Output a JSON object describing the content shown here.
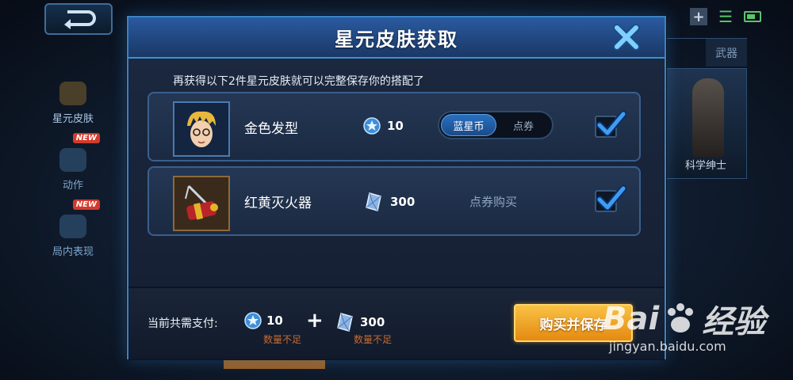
{
  "background": {
    "side_tabs": [
      {
        "label": "星元皮肤",
        "badge": ""
      },
      {
        "label": "动作",
        "badge": "NEW"
      },
      {
        "label": "局内表现",
        "badge": "NEW"
      }
    ],
    "right_tabs": [
      "",
      "武器"
    ],
    "hero_card_label": "科学绅士"
  },
  "modal": {
    "title": "星元皮肤获取",
    "subtitle": "再获得以下2件星元皮肤就可以完整保存你的搭配了",
    "items": [
      {
        "name": "金色发型",
        "price": "10",
        "price_currency": "blue-star-coin",
        "currency_options": [
          "蓝星币",
          "点券"
        ],
        "selected_currency": "蓝星币",
        "checked": true
      },
      {
        "name": "红黄灭火器",
        "price": "300",
        "price_currency": "voucher-crystal",
        "purchase_text": "点券购买",
        "checked": true
      }
    ],
    "footer": {
      "total_label": "当前共需支付:",
      "cost1": "10",
      "cost1_note": "数量不足",
      "plus": "+",
      "cost2": "300",
      "cost2_note": "数量不足",
      "buy_button": "购买并保存"
    }
  },
  "watermark": {
    "logo_text": "Bai",
    "logo_text2": "经验",
    "url": "jingyan.baidu.com"
  },
  "colors": {
    "accent_blue": "#3b82c6",
    "buy_orange": "#e48a12",
    "warning": "#c96a2e"
  }
}
